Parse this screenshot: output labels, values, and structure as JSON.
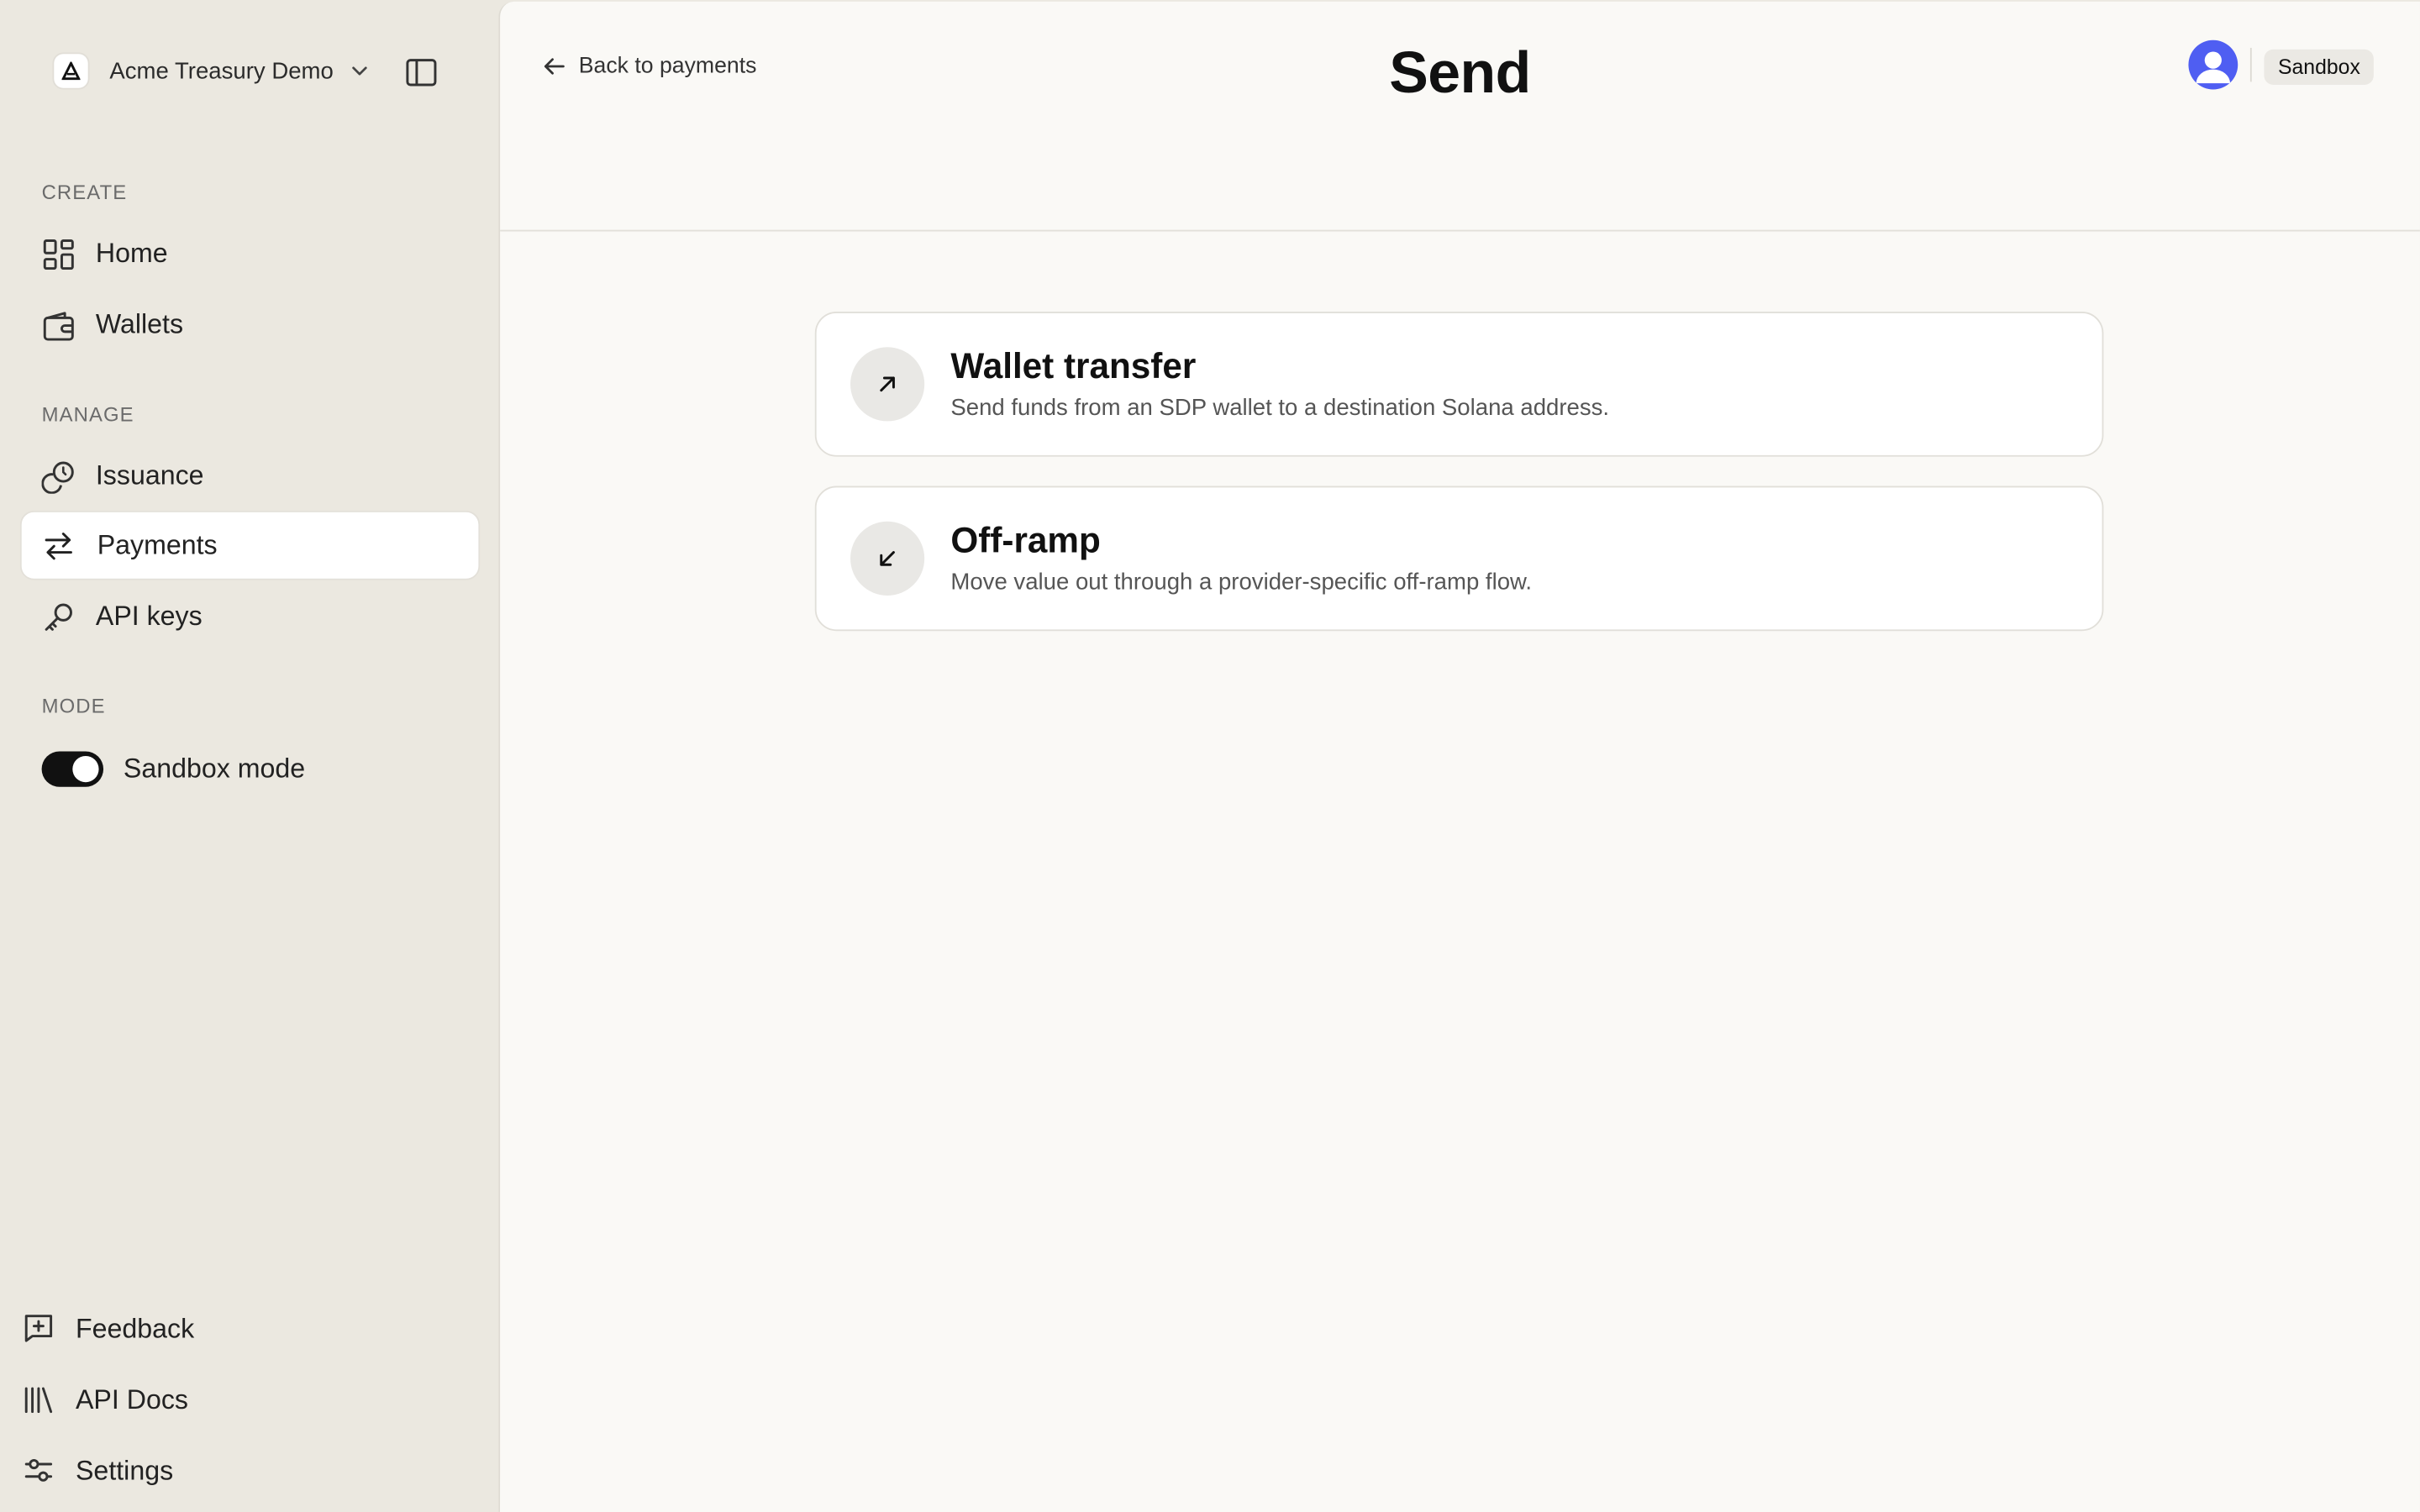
{
  "sidebar": {
    "org_name": "Acme Treasury Demo",
    "sections": {
      "create": "CREATE",
      "manage": "MANAGE",
      "mode": "MODE"
    },
    "items": [
      {
        "label": "Home",
        "icon": "grid-icon"
      },
      {
        "label": "Wallets",
        "icon": "wallet-icon"
      },
      {
        "label": "Issuance",
        "icon": "coins-icon"
      },
      {
        "label": "Payments",
        "icon": "arrows-left-right-icon",
        "active": true
      },
      {
        "label": "API keys",
        "icon": "key-icon"
      }
    ],
    "mode_toggle": {
      "label": "Sandbox mode",
      "on": true
    },
    "footer": [
      {
        "label": "Feedback",
        "icon": "message-plus-icon"
      },
      {
        "label": "API Docs",
        "icon": "library-icon"
      },
      {
        "label": "Settings",
        "icon": "sliders-icon"
      }
    ]
  },
  "header": {
    "back_label": "Back to payments",
    "title": "Send",
    "env_badge": "Sandbox"
  },
  "options": [
    {
      "title": "Wallet transfer",
      "description": "Send funds from an SDP wallet to a destination Solana address.",
      "icon": "arrow-up-right-icon"
    },
    {
      "title": "Off-ramp",
      "description": "Move value out through a provider-specific off-ramp flow.",
      "icon": "arrow-down-left-icon"
    }
  ],
  "colors": {
    "sidebar_bg": "#ebe8e0",
    "main_bg": "#faf9f6",
    "avatar": "#4f5ef2"
  }
}
